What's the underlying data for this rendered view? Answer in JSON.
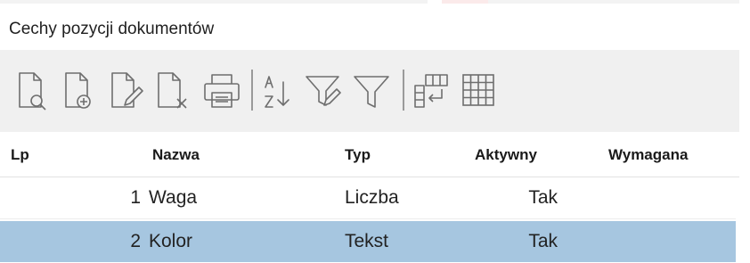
{
  "panel": {
    "title": "Cechy pozycji dokumentów"
  },
  "colors": {
    "toolbar_bg": "#f0f0f0",
    "selected_row_bg": "#a6c6e0",
    "icon_stroke": "#6e6e6e"
  },
  "toolbar": {
    "buttons": [
      {
        "icon": "document-preview-icon"
      },
      {
        "icon": "document-add-icon"
      },
      {
        "icon": "document-edit-icon"
      },
      {
        "icon": "document-delete-icon"
      },
      {
        "icon": "printer-icon"
      },
      {
        "icon": "sort-az-icon"
      },
      {
        "icon": "filter-edit-icon"
      },
      {
        "icon": "filter-icon"
      },
      {
        "icon": "insert-row-icon"
      },
      {
        "icon": "table-grid-icon"
      }
    ]
  },
  "grid": {
    "columns": {
      "lp": "Lp",
      "nazwa": "Nazwa",
      "typ": "Typ",
      "aktywny": "Aktywny",
      "wymagana": "Wymagana"
    },
    "rows": [
      {
        "lp": "1",
        "nazwa": "Waga",
        "typ": "Liczba",
        "aktywny": "Tak",
        "wymagana": ""
      },
      {
        "lp": "2",
        "nazwa": "Kolor",
        "typ": "Tekst",
        "aktywny": "Tak",
        "wymagana": ""
      }
    ],
    "selected_row": 2
  }
}
